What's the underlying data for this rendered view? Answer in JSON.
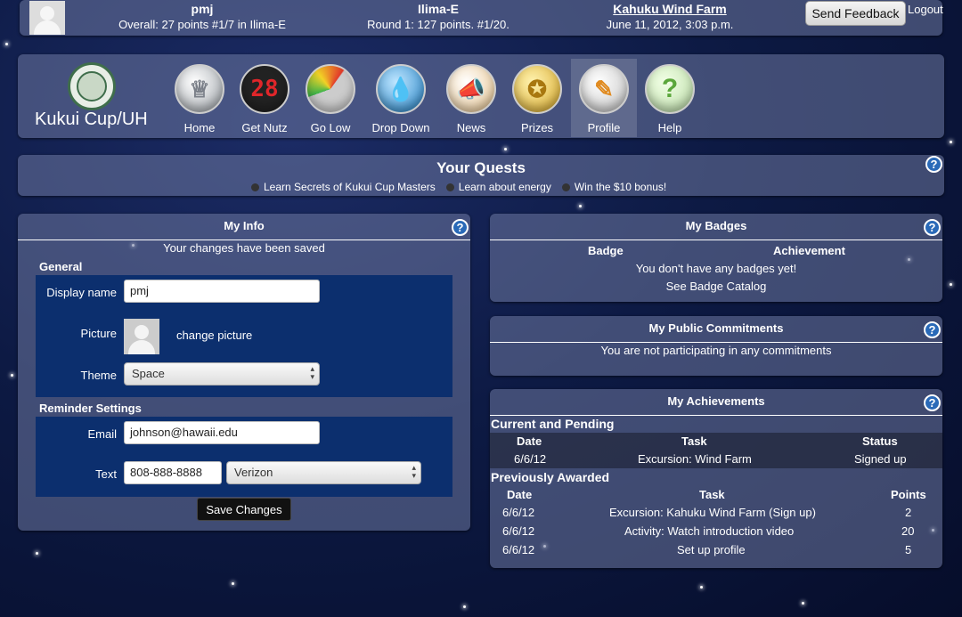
{
  "header": {
    "user_name": "pmj",
    "overall": "Overall: 27 points #1/7 in Ilima-E",
    "team_name": "Ilima-E",
    "round": "Round 1: 127 points. #1/20.",
    "event_link": "Kahuku Wind Farm",
    "event_date": "June 11, 2012, 3:03 p.m.",
    "feedback_button": "Send Feedback",
    "logout": "Logout"
  },
  "brand": {
    "title": "Kukui Cup/UH"
  },
  "nav": [
    {
      "label": "Home",
      "icon": "trophy-icon"
    },
    {
      "label": "Get Nutz",
      "icon": "scoreboard-icon",
      "glyph": "28"
    },
    {
      "label": "Go Low",
      "icon": "gauge-icon"
    },
    {
      "label": "Drop Down",
      "icon": "water-drop-icon"
    },
    {
      "label": "News",
      "icon": "megaphone-icon"
    },
    {
      "label": "Prizes",
      "icon": "medal-icon"
    },
    {
      "label": "Profile",
      "icon": "clipboard-icon"
    },
    {
      "label": "Help",
      "icon": "question-icon",
      "glyph": "?"
    }
  ],
  "quests": {
    "title": "Your Quests",
    "items": [
      "Learn Secrets of Kukui Cup Masters",
      "Learn about energy",
      "Win the $10 bonus!"
    ]
  },
  "my_info": {
    "title": "My Info",
    "saved_msg": "Your changes have been saved",
    "general": "General",
    "display_name_label": "Display name",
    "display_name_value": "pmj",
    "picture_label": "Picture",
    "change_picture": "change picture",
    "theme_label": "Theme",
    "theme_value": "Space",
    "reminder": "Reminder Settings",
    "email_label": "Email",
    "email_value": "johnson@hawaii.edu",
    "text_label": "Text",
    "text_value": "808-888-8888",
    "carrier_value": "Verizon",
    "save_button": "Save Changes"
  },
  "badges": {
    "title": "My Badges",
    "col_badge": "Badge",
    "col_achievement": "Achievement",
    "empty": "You don't have any badges yet!",
    "catalog": "See Badge Catalog"
  },
  "commitments": {
    "title": "My Public Commitments",
    "empty": "You are not participating in any commitments"
  },
  "achievements": {
    "title": "My Achievements",
    "current_title": "Current and Pending",
    "current_cols": [
      "Date",
      "Task",
      "Status"
    ],
    "current_rows": [
      [
        "6/6/12",
        "Excursion: Wind Farm",
        "Signed up"
      ]
    ],
    "prev_title": "Previously Awarded",
    "prev_cols": [
      "Date",
      "Task",
      "Points"
    ],
    "prev_rows": [
      [
        "6/6/12",
        "Excursion: Kahuku Wind Farm (Sign up)",
        "2"
      ],
      [
        "6/6/12",
        "Activity: Watch introduction video",
        "20"
      ],
      [
        "6/6/12",
        "Set up profile",
        "5"
      ]
    ]
  },
  "help_glyph": "?"
}
